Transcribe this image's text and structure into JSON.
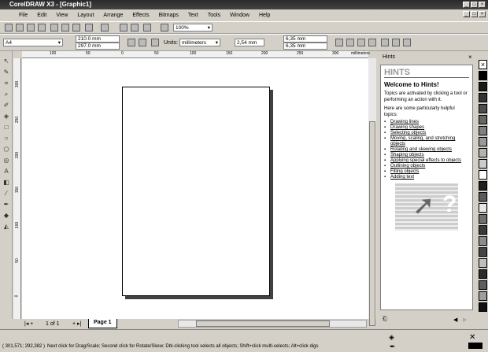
{
  "window": {
    "title": "CorelDRAW X3 - [Graphic1]"
  },
  "menu": [
    "File",
    "Edit",
    "View",
    "Layout",
    "Arrange",
    "Effects",
    "Bitmaps",
    "Text",
    "Tools",
    "Window",
    "Help"
  ],
  "toolbar": {
    "zoom": "100%"
  },
  "property_bar": {
    "paper": "A4",
    "width": "210.0 mm",
    "height": "297.0 mm",
    "units_label": "Units:",
    "units": "millimeters",
    "nudge": "2,54 mm",
    "dup_x": "6,35 mm",
    "dup_y": "6,35 mm"
  },
  "ruler": {
    "h_labels": [
      "100",
      "50",
      "0",
      "50",
      "100",
      "150",
      "200",
      "250",
      "300"
    ],
    "unit": "millimeters",
    "v_labels": [
      "300",
      "250",
      "200",
      "150",
      "100",
      "50",
      "0"
    ]
  },
  "page_nav": {
    "count": "1 of 1",
    "tab": "Page 1"
  },
  "hints": {
    "panel_title": "Hints",
    "header": "HINTS",
    "welcome": "Welcome to Hints!",
    "intro": "Topics are activated by clicking a tool or performing an action with it.",
    "helpful": "Here are some particularly helpful topics:",
    "topics": [
      "Drawing lines",
      "Drawing shapes",
      "Selecting objects",
      "Moving, scaling, and stretching objects",
      "Rotating and skewing objects",
      "Shaping objects",
      "Applying special effects to objects",
      "Outlining objects",
      "Filling objects",
      "Adding text"
    ]
  },
  "palette": [
    "#000000",
    "#1a1a1a",
    "#333333",
    "#4d4d4d",
    "#666666",
    "#808080",
    "#999999",
    "#b3b3b3",
    "#cccccc",
    "#ffffff",
    "#202020",
    "#5a5a5a",
    "#e6e6e6",
    "#707070",
    "#3a3a3a",
    "#8c8c8c",
    "#444444",
    "#bfbfbf",
    "#2b2b2b",
    "#5e5e5e",
    "#9e9e9e",
    "#111111"
  ],
  "status": {
    "coords": "( 301,571; 292,382 )",
    "message": "Next click for Drag/Scale; Second click for Rotate/Skew; Dbl-clicking tool selects all objects; Shift+click multi-selects; Alt+click digs"
  }
}
